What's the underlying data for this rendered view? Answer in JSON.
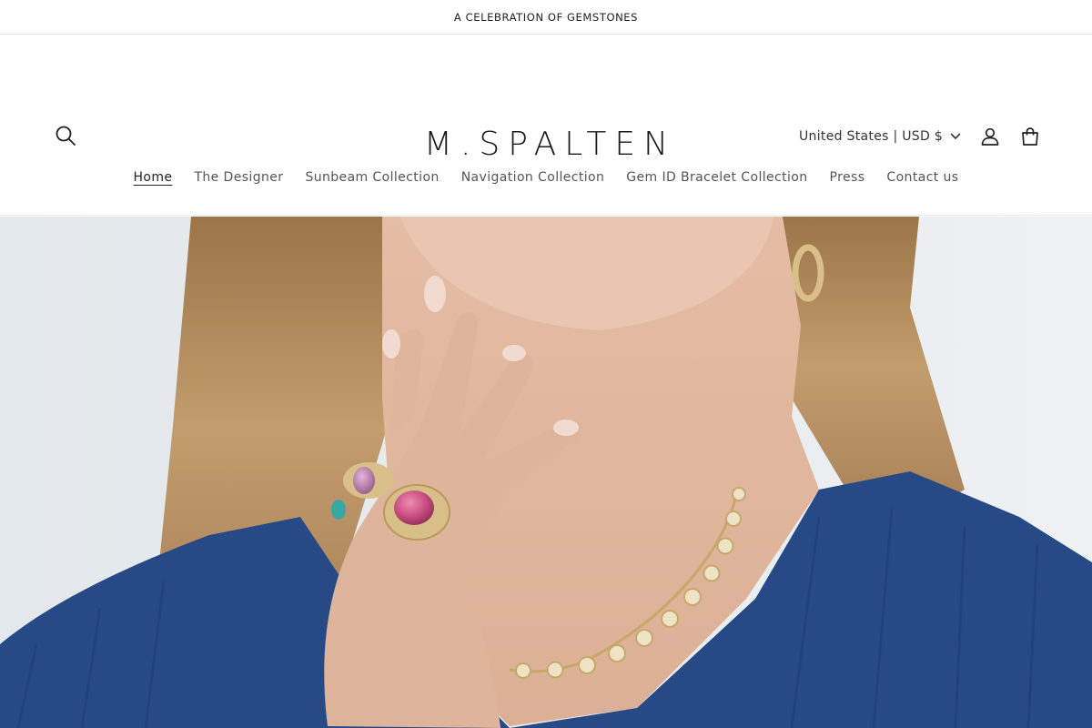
{
  "announcement": {
    "text": "A CELEBRATION OF GEMSTONES"
  },
  "header": {
    "logo": "M.SPALTEN",
    "locale_label": "United States | USD $",
    "icons": {
      "search": "search-icon",
      "account": "account-icon",
      "cart": "cart-icon",
      "chevron": "chevron-down-icon"
    }
  },
  "nav": {
    "items": [
      {
        "label": "Home",
        "active": true
      },
      {
        "label": "The Designer"
      },
      {
        "label": "Sunbeam Collection"
      },
      {
        "label": "Navigation Collection"
      },
      {
        "label": "Gem ID Bracelet Collection"
      },
      {
        "label": "Press"
      },
      {
        "label": "Contact us"
      }
    ]
  },
  "hero": {
    "image": "model wearing gold necklace and gemstone rings",
    "colors": {
      "sweater": "#274a86",
      "skin": "#e6c3ac",
      "hair": "#b48a5a",
      "background": "#e9ecef",
      "gold": "#d9c08a",
      "tourmaline": "#c74a7e"
    }
  }
}
